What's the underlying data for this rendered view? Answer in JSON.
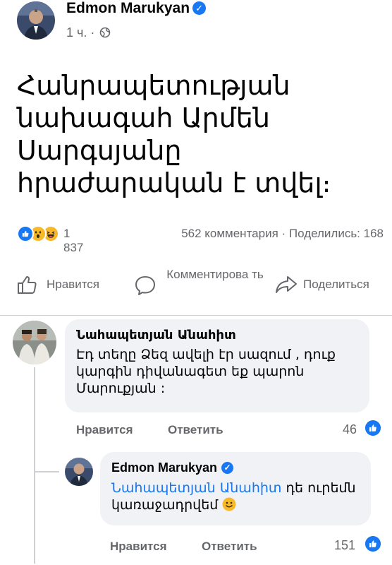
{
  "post": {
    "author": "Edmon Marukyan",
    "time": "1 ч.",
    "separator": "·",
    "text": "Հանրապետության նախագահ Արմեն Սարգսյանը հրաժարական է տվել։",
    "icons": {
      "verified": "verified-badge-icon",
      "globe": "globe-icon"
    }
  },
  "stats": {
    "reactions_count": "1 837",
    "comments_shares": "562 комментария · Поделились: 168",
    "reaction_icons": [
      "like-reaction-icon",
      "wow-reaction-icon",
      "haha-reaction-icon"
    ]
  },
  "actions": {
    "like_label": "Нравится",
    "comment_label": "Комментирова ть",
    "share_label": "Поделиться"
  },
  "comments": [
    {
      "author": "Նահապետյան Անահիտ",
      "text": "Էդ տեղը Ձեզ ավելի էր սազում , դուք կարգին դիվանագետ եք պարոն Մարուքյան :",
      "like_label": "Нравится",
      "reply_label": "Ответить",
      "likes": "46"
    }
  ],
  "reply": {
    "author": "Edmon Marukyan",
    "mention": "Նահապետյան Անահիտ",
    "text": " դե ուրեմն կառաջադրվեմ",
    "like_label": "Нравится",
    "reply_label": "Ответить",
    "likes": "151"
  },
  "colors": {
    "accent": "#1877f2",
    "secondary_text": "#65676b",
    "bubble": "#f0f2f5",
    "reaction_yellow": "#f7b928"
  }
}
